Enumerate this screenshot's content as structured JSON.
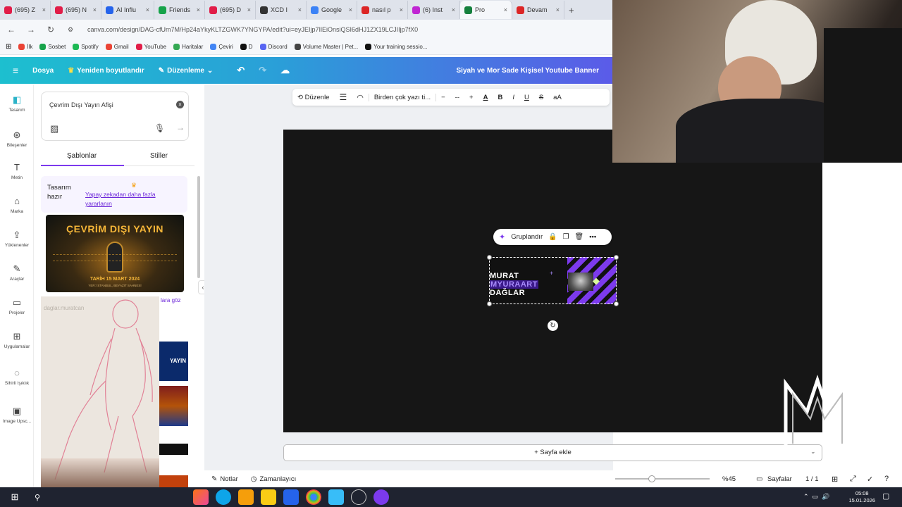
{
  "browser": {
    "tabs": [
      {
        "label": "(695) Z",
        "color": "#e11d48"
      },
      {
        "label": "(695) N",
        "color": "#e11d48"
      },
      {
        "label": "AI Influ",
        "color": "#2563eb"
      },
      {
        "label": "Friends",
        "color": "#16a34a"
      },
      {
        "label": "(695) D",
        "color": "#e11d48"
      },
      {
        "label": "XCD I",
        "color": "#333333"
      },
      {
        "label": "Google",
        "color": "#3b82f6"
      },
      {
        "label": "nasıl p",
        "color": "#dc2626"
      },
      {
        "label": "(6) Inst",
        "color": "#c026d3"
      },
      {
        "label": "Pro",
        "color": "#15803d"
      },
      {
        "label": "Devam",
        "color": "#dc2626"
      }
    ],
    "url": "canva.com/design/DAG-cfUm7M/Hp24aYkyKLTZGWK7YNGYPA/edit?ui=eyJEIjp7IlEiOnsiQSI6dHJ1ZX19LCJIIjp7fX0",
    "bookmarks": [
      "İlk",
      "Sosbet",
      "Spotify",
      "Gmail",
      "YouTube",
      "Haritalar",
      "Çeviri",
      "D",
      "Discord",
      "Volume Master | Pet...",
      "Your training sessio..."
    ]
  },
  "canva_bar": {
    "file": "Dosya",
    "resize": "Yeniden boyutlandır",
    "edit": "Düzenleme",
    "design_title": "Siyah ve Mor Sade Kişisel Youtube Banner"
  },
  "rail": [
    {
      "label": "Tasarım",
      "icon": "design-icon",
      "glyph": "◧"
    },
    {
      "label": "Bileşenler",
      "icon": "elements-icon",
      "glyph": "⊛"
    },
    {
      "label": "Metin",
      "icon": "text-icon",
      "glyph": "T"
    },
    {
      "label": "Marka",
      "icon": "brand-icon",
      "glyph": "⌂"
    },
    {
      "label": "Yüklenenler",
      "icon": "uploads-icon",
      "glyph": "⇪"
    },
    {
      "label": "Araçlar",
      "icon": "draw-icon",
      "glyph": "✎"
    },
    {
      "label": "Projeler",
      "icon": "projects-icon",
      "glyph": "▭"
    },
    {
      "label": "Uygulamalar",
      "icon": "apps-icon",
      "glyph": "⊞"
    },
    {
      "label": "Sihirli Işıklık",
      "icon": "magic-icon",
      "glyph": "◌"
    },
    {
      "label": "Image Upsc...",
      "icon": "image-upscale-icon",
      "glyph": "▣"
    }
  ],
  "panel": {
    "prompt": "Çevrim Dışı Yayın Afişi",
    "tabs": [
      "Şablonlar",
      "Stiller"
    ],
    "hint_title": "Tasarım hazır",
    "hint_link": "Yapay zekadan daha fazla yararlanın",
    "template_title": "ÇEVRİM DIŞI YAYIN",
    "template_date": "TARİH 15 MART 2024",
    "template_small": "YER: İSTANBUL, BEYAZIT SAHNESİ",
    "side_note": "lara göz",
    "watermark_handle": "daglar.muratcan"
  },
  "context_toolbar": {
    "edit": "Düzenle",
    "font": "Birden çok yazı ti...",
    "size": "--",
    "bold": "B",
    "italic": "I",
    "underline": "U",
    "strike": "S",
    "case": "aA"
  },
  "selection": {
    "group_label": "Gruplandır",
    "banner_line1": "MURAT",
    "banner_line2": "MYURAART",
    "banner_line3": "DAĞLAR"
  },
  "add_page": "+ Sayfa ekle",
  "footer": {
    "notes": "Notlar",
    "timer": "Zamanlayıcı",
    "zoom": "%45",
    "pages": "Sayfalar",
    "page_count": "1 / 1",
    "zoom_fraction": 0.39
  },
  "clock": {
    "time": "05:08",
    "date": "15.01.2026"
  },
  "colors": {
    "accent": "#7c3aed",
    "canva_gradient_start": "#1dbfcf",
    "canva_gradient_end": "#5b5be8",
    "banner_purple": "#7c3aed",
    "banner_lime": "#d9f99d"
  }
}
